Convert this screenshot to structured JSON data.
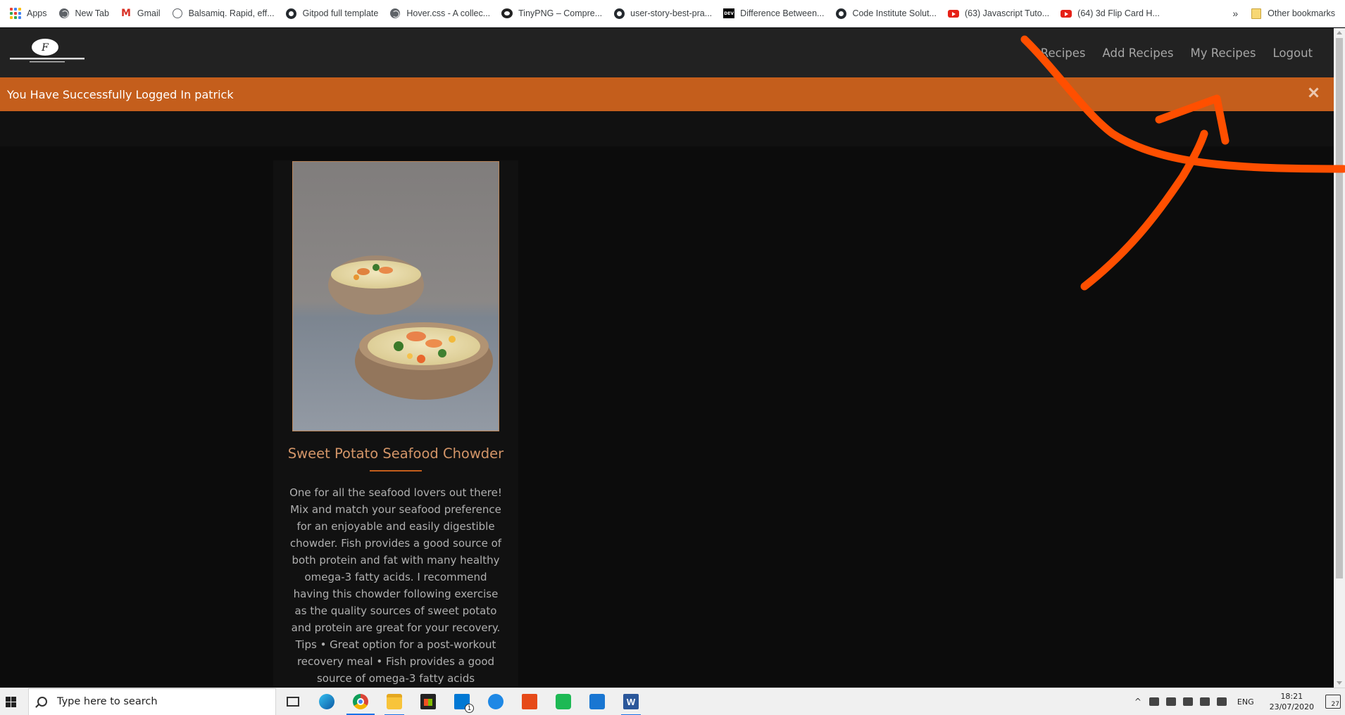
{
  "bookmarks": [
    {
      "label": "Apps",
      "icon": "apps-grid-icon"
    },
    {
      "label": "New Tab",
      "icon": "globe-icon"
    },
    {
      "label": "Gmail",
      "icon": "gmail-icon"
    },
    {
      "label": "Balsamiq. Rapid, eff...",
      "icon": "smiley-icon"
    },
    {
      "label": "Gitpod full template",
      "icon": "github-icon"
    },
    {
      "label": "Hover.css - A collec...",
      "icon": "globe-icon"
    },
    {
      "label": "TinyPNG – Compre...",
      "icon": "panda-icon"
    },
    {
      "label": "user-story-best-pra...",
      "icon": "github-icon"
    },
    {
      "label": "Difference Between...",
      "icon": "dev-icon"
    },
    {
      "label": "Code Institute Solut...",
      "icon": "github-icon"
    },
    {
      "label": "(63) Javascript Tuto...",
      "icon": "youtube-icon"
    },
    {
      "label": "(64) 3d Flip Card H...",
      "icon": "youtube-icon"
    }
  ],
  "bookmarks_overflow": "»",
  "other_bookmarks": "Other bookmarks",
  "logo_icon": "fitness-kitchen-logo",
  "nav": {
    "recipes": "Recipes",
    "add_recipes": "Add Recipes",
    "my_recipes": "My Recipes",
    "logout": "Logout"
  },
  "flash": {
    "message": "You Have Successfully Logged In patrick",
    "close_icon": "close-icon"
  },
  "recipe": {
    "title": "Sweet Potato Seafood Chowder",
    "description": "One for all the seafood lovers out there! Mix and match your seafood preference for an enjoyable and easily digestible chowder. Fish provides a good source of both protein and fat with many healthy omega-3 fatty acids. I recommend having this chowder following exercise as the quality sources of sweet potato and protein are great for your recovery. Tips • Great option for a post-workout recovery meal • Fish provides a good source of omega-3 fatty acids"
  },
  "colors": {
    "accent": "#c45e1c",
    "title": "#d39568",
    "navbar": "#222222",
    "page_bg": "#0c0c0c",
    "annotation": "#ff4f00"
  },
  "taskbar": {
    "search_placeholder": "Type here to search",
    "apps": [
      "task-view-icon",
      "edge-icon",
      "chrome-icon",
      "file-explorer-icon",
      "store-icon",
      "mail-icon",
      "messenger-icon",
      "office-icon",
      "spotify-icon",
      "snipping-icon",
      "word-icon"
    ],
    "mail_badge": "1",
    "language": "ENG",
    "time": "18:21",
    "date": "23/07/2020",
    "notification_count": "27"
  }
}
